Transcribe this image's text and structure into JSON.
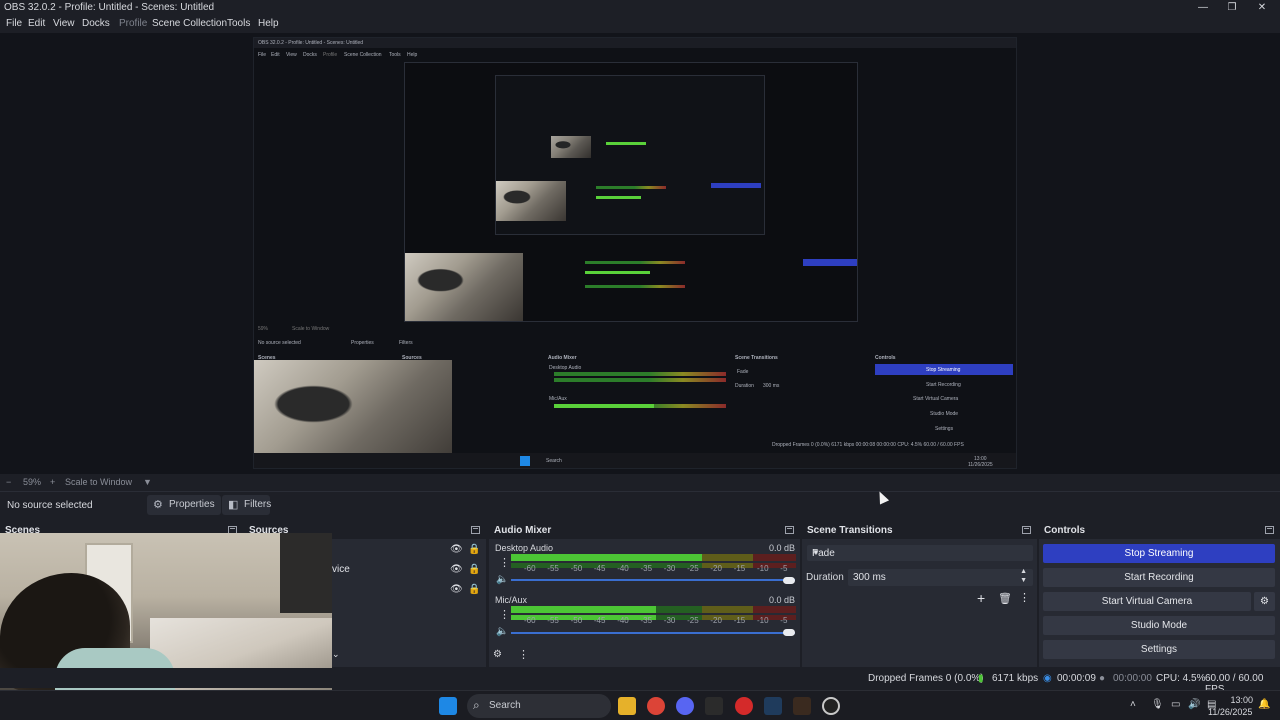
{
  "window": {
    "title": "OBS 32.0.2 - Profile: Untitled - Scenes: Untitled",
    "minimize": "—",
    "maximize": "❐",
    "close": "✕"
  },
  "menu": [
    "File",
    "Edit",
    "View",
    "Docks",
    "Profile",
    "Scene Collection",
    "Tools",
    "Help"
  ],
  "nested": {
    "title": "OBS 32.0.2 - Profile: Untitled - Scenes: Untitled",
    "menu": [
      "File",
      "Edit",
      "View",
      "Docks",
      "Profile",
      "Scene Collection",
      "Tools",
      "Help"
    ],
    "no_source": "No source selected",
    "properties": "Properties",
    "filters": "Filters",
    "scenes": "Scenes",
    "sources": "Sources",
    "audio_mixer": "Audio Mixer",
    "scene_transitions": "Scene Transitions",
    "controls": "Controls",
    "desktop_audio": "Desktop Audio",
    "mic_aux": "Mic/Aux",
    "fade": "Fade",
    "duration": "Duration",
    "duration_value": "300 ms",
    "stop_streaming": "Stop Streaming",
    "start_recording": "Start Recording",
    "start_virtual_camera": "Start Virtual Camera",
    "studio_mode": "Studio Mode",
    "settings": "Settings",
    "status": "Dropped Frames 0 (0.0%)   6171 kbps   00:00:08   00:00:00   CPU: 4.5%   60.00 / 60.00 FPS",
    "zoom": "59%",
    "scale": "Scale to Window",
    "search": "Search",
    "time": "13:00",
    "date": "11/26/2025"
  },
  "zoom": {
    "value": "59%",
    "scale_mode": "Scale to Window"
  },
  "source_bar": {
    "no_source": "No source selected",
    "properties": "Properties",
    "filters": "Filters"
  },
  "docks": {
    "scenes": "Scenes",
    "sources": "Sources",
    "audio_mixer": "Audio Mixer",
    "scene_transitions": "Scene Transitions",
    "controls": "Controls"
  },
  "sources_rows": {
    "partial_label": "vice"
  },
  "audio": {
    "channels": [
      {
        "name": "Desktop Audio",
        "db": "0.0 dB",
        "level": 0.67
      },
      {
        "name": "Mic/Aux",
        "db": "0.0 dB",
        "level": 0.51
      }
    ],
    "scale": [
      "-60",
      "-55",
      "-50",
      "-45",
      "-40",
      "-35",
      "-30",
      "-25",
      "-20",
      "-15",
      "-10",
      "-5",
      "0"
    ]
  },
  "transitions": {
    "selected": "Fade",
    "duration_label": "Duration",
    "duration_value": "300 ms"
  },
  "controls": {
    "stop_streaming": "Stop Streaming",
    "start_recording": "Start Recording",
    "start_virtual_camera": "Start Virtual Camera",
    "studio_mode": "Studio Mode",
    "settings": "Settings"
  },
  "status": {
    "dropped_frames": "Dropped Frames 0 (0.0%)",
    "bitrate": "6171 kbps",
    "stream_time": "00:00:09",
    "rec_time": "00:00:00",
    "cpu": "CPU: 4.5%",
    "fps": "60.00 / 60.00 FPS"
  },
  "taskbar": {
    "search": "Search",
    "time": "13:00",
    "date": "11/26/2025"
  },
  "colors": {
    "accent": "#2e3fc1",
    "bg": "#1d1f26",
    "dock": "#272a33",
    "meter_green": "#4cc535"
  }
}
